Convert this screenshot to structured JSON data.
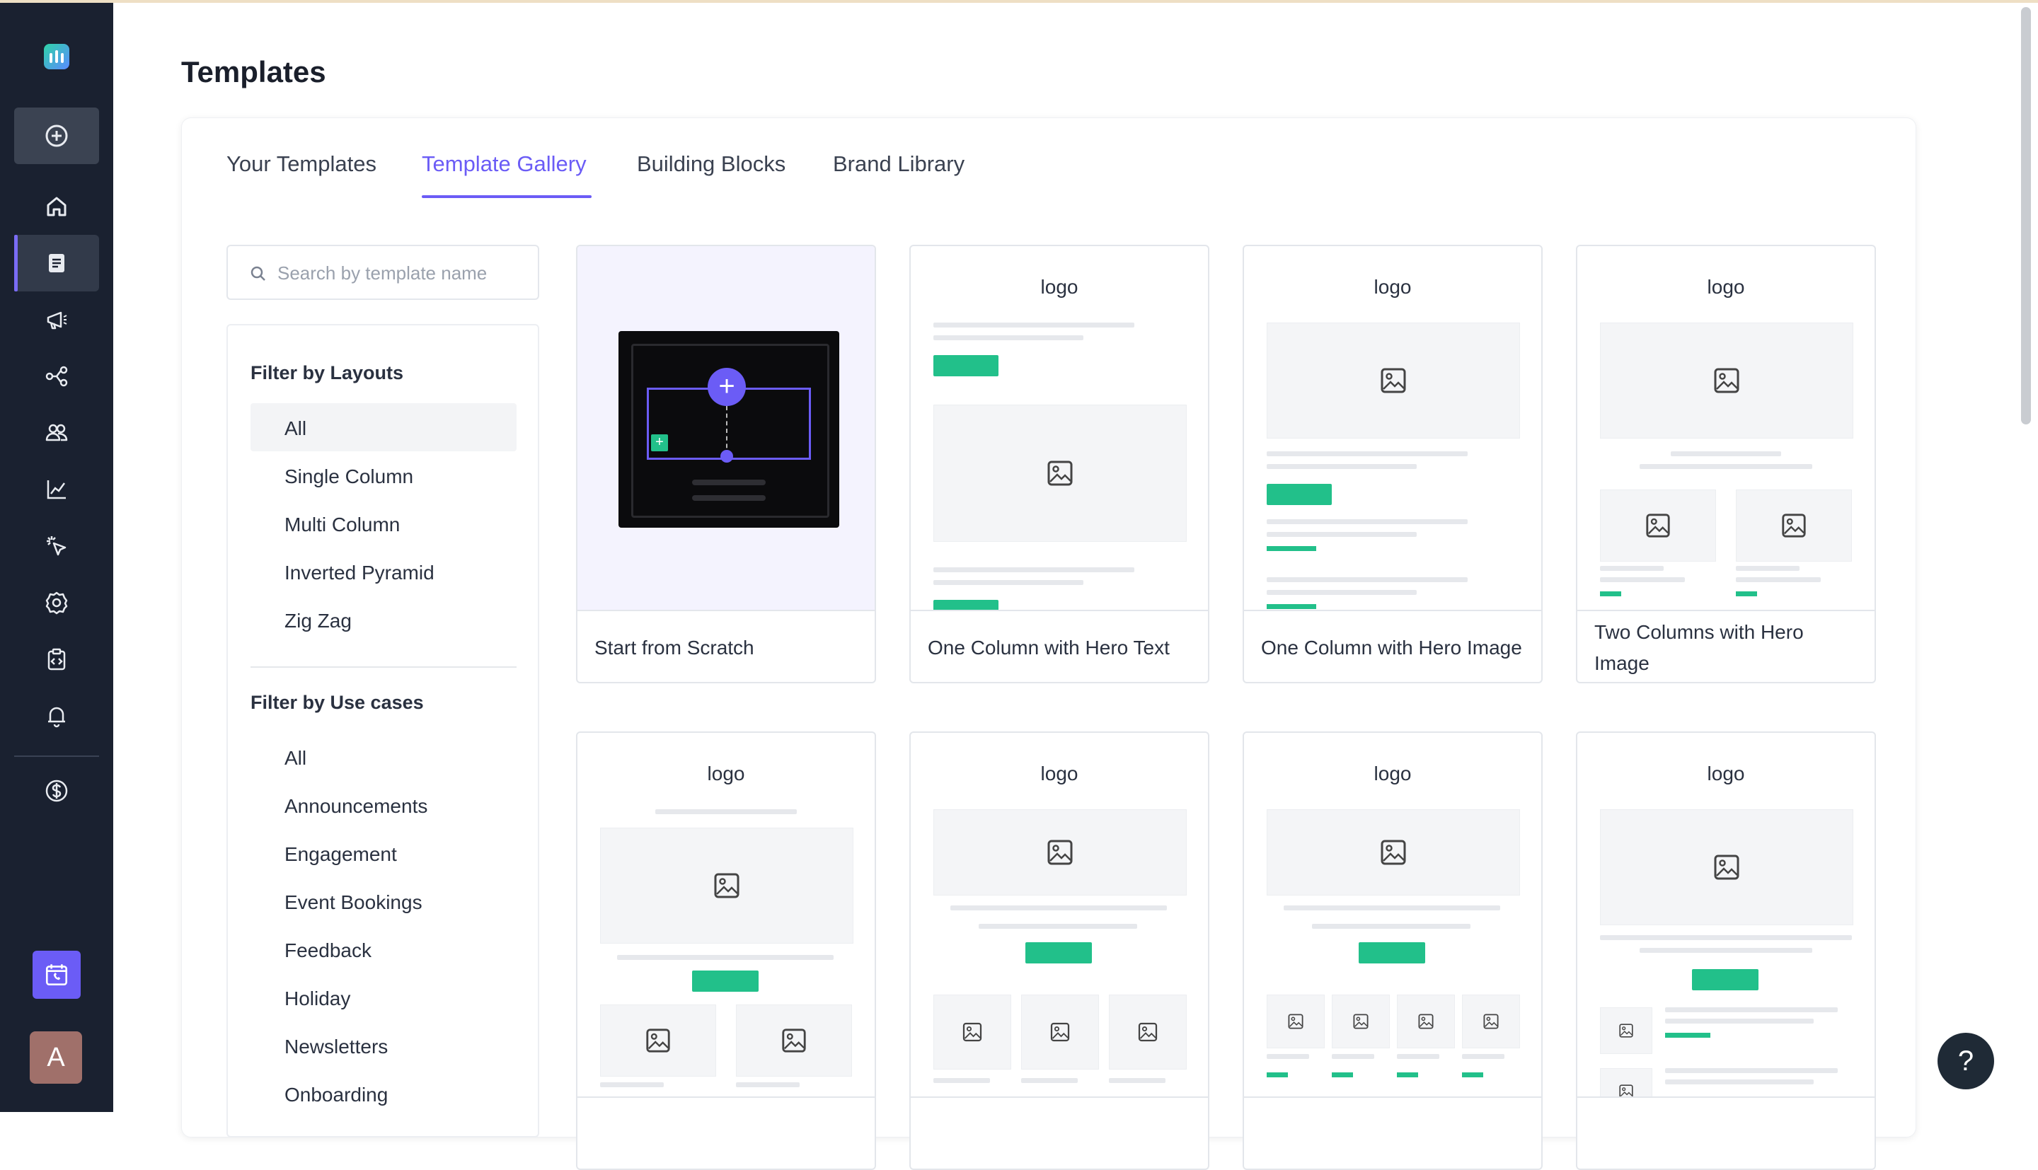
{
  "page": {
    "title": "Templates",
    "help_label": "?"
  },
  "sidebar": {
    "avatar_initial": "A",
    "items": [
      {
        "icon": "plus-circle-icon"
      },
      {
        "icon": "home-icon"
      },
      {
        "icon": "template-icon",
        "active": true
      },
      {
        "icon": "megaphone-icon"
      },
      {
        "icon": "share-flow-icon"
      },
      {
        "icon": "users-icon"
      },
      {
        "icon": "analytics-icon"
      },
      {
        "icon": "cursor-click-icon"
      },
      {
        "icon": "settings-icon"
      },
      {
        "icon": "code-clipboard-icon"
      },
      {
        "icon": "bell-icon"
      },
      {
        "icon": "dollar-icon"
      },
      {
        "icon": "calendar-phone-icon"
      }
    ]
  },
  "tabs": [
    {
      "label": "Your Templates"
    },
    {
      "label": "Template Gallery",
      "active": true
    },
    {
      "label": "Building Blocks"
    },
    {
      "label": "Brand Library"
    }
  ],
  "search": {
    "placeholder": "Search by template name",
    "value": ""
  },
  "filters": {
    "layouts_title": "Filter by Layouts",
    "layouts": [
      "All",
      "Single Column",
      "Multi Column",
      "Inverted Pyramid",
      "Zig Zag"
    ],
    "layouts_selected": "All",
    "usecases_title": "Filter by Use cases",
    "usecases": [
      "All",
      "Announcements",
      "Engagement",
      "Event Bookings",
      "Feedback",
      "Holiday",
      "Newsletters",
      "Onboarding"
    ]
  },
  "templates": [
    {
      "name": "Start from Scratch"
    },
    {
      "name": "One Column with Hero Text",
      "logo": "logo"
    },
    {
      "name": "One Column with Hero Image",
      "logo": "logo"
    },
    {
      "name": "Two Columns with Hero Image",
      "logo": "logo"
    },
    {
      "name": "",
      "logo": "logo"
    },
    {
      "name": "",
      "logo": "logo"
    },
    {
      "name": "",
      "logo": "logo"
    },
    {
      "name": "",
      "logo": "logo"
    }
  ],
  "colors": {
    "accent": "#6b5cf6",
    "sidebar_bg": "#1a2130",
    "green_button": "#22c08a"
  }
}
